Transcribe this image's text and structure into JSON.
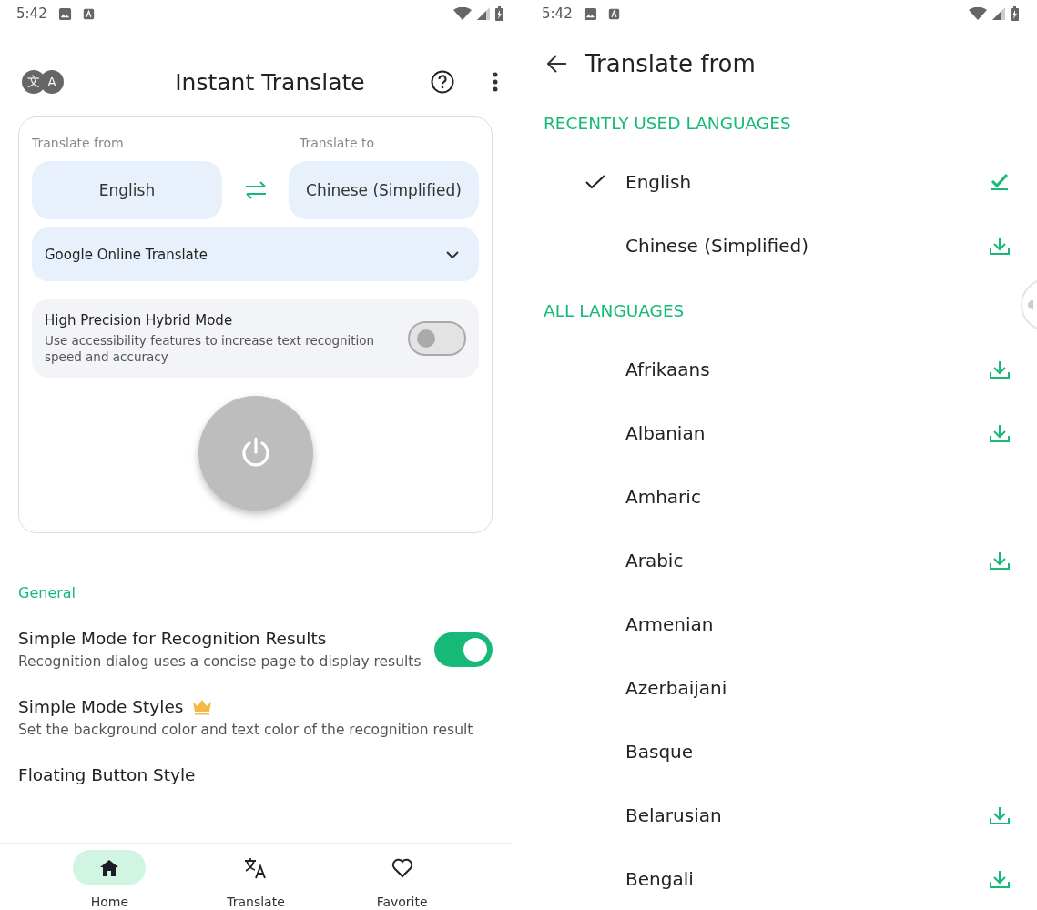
{
  "left_screen": {
    "status_bar": {
      "time": "5:42"
    },
    "app_bar": {
      "title": "Instant Translate",
      "logo_letters": [
        "文",
        "A"
      ]
    },
    "translate_card": {
      "from_label": "Translate from",
      "to_label": "Translate to",
      "from_language": "English",
      "to_language": "Chinese (Simplified)",
      "engine": "Google Online Translate",
      "hybrid_mode": {
        "title": "High Precision Hybrid Mode",
        "description": "Use accessibility features to increase text recognition speed and accuracy",
        "on": false
      },
      "power_on": false
    },
    "section_title": "General",
    "settings": [
      {
        "kind": "toggle",
        "title": "Simple Mode for Recognition Results",
        "description": "Recognition dialog uses a concise page to display results",
        "on": true,
        "premium": false
      },
      {
        "kind": "link",
        "title": "Simple Mode Styles",
        "description": "Set the background color and text color of the recognition result",
        "premium": true
      },
      {
        "kind": "link",
        "title": "Floating Button Style",
        "premium": false
      }
    ],
    "bottom_nav": [
      {
        "label": "Home",
        "selected": true
      },
      {
        "label": "Translate",
        "selected": false
      },
      {
        "label": "Favorite",
        "selected": false
      }
    ]
  },
  "right_screen": {
    "status_bar": {
      "time": "5:42"
    },
    "app_bar": {
      "title": "Translate from"
    },
    "sections": [
      {
        "title": "RECENTLY USED LANGUAGES",
        "languages": [
          {
            "name": "English",
            "selected": true,
            "kind": "downloaded"
          },
          {
            "name": "Chinese (Simplified)",
            "selected": false,
            "kind": "downloadable"
          }
        ]
      },
      {
        "title": "ALL LANGUAGES",
        "languages": [
          {
            "name": "Afrikaans",
            "selected": false,
            "kind": "downloadable"
          },
          {
            "name": "Albanian",
            "selected": false,
            "kind": "downloadable"
          },
          {
            "name": "Amharic",
            "selected": false,
            "kind": "plain"
          },
          {
            "name": "Arabic",
            "selected": false,
            "kind": "downloadable"
          },
          {
            "name": "Armenian",
            "selected": false,
            "kind": "plain"
          },
          {
            "name": "Azerbaijani",
            "selected": false,
            "kind": "plain"
          },
          {
            "name": "Basque",
            "selected": false,
            "kind": "plain"
          },
          {
            "name": "Belarusian",
            "selected": false,
            "kind": "downloadable"
          },
          {
            "name": "Bengali",
            "selected": false,
            "kind": "downloadable"
          }
        ]
      }
    ]
  }
}
